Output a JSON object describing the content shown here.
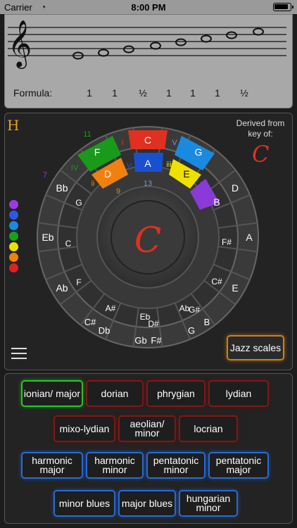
{
  "status_bar": {
    "carrier": "Carrier",
    "time": "8:00 PM"
  },
  "staff": {
    "formula_label": "Formula:",
    "steps": [
      "1",
      "1",
      "½",
      "1",
      "1",
      "1",
      "½"
    ]
  },
  "wheel": {
    "derived_label": "Derived from key of:",
    "derived_key": "C",
    "center_key": "C",
    "h_label": "H",
    "highlighted": [
      {
        "note": "C",
        "color": "#e03020"
      },
      {
        "note": "G",
        "color": "#1a8ae0"
      },
      {
        "note": "E",
        "color": "#f0e000"
      },
      {
        "note": "B",
        "color": "#8a3ad8"
      },
      {
        "note": "A",
        "color": "#1a50d0"
      },
      {
        "note": "D",
        "color": "#f08010"
      },
      {
        "note": "F",
        "color": "#1a9a1a"
      }
    ],
    "roman": [
      "I",
      "V",
      "iii",
      "vii",
      "vi",
      "ii",
      "IV"
    ],
    "degree_numbers": [
      "11",
      "7",
      "9",
      "13"
    ],
    "outer_notes": [
      "C",
      "G",
      "D",
      "A",
      "E",
      "B",
      "F#",
      "C#",
      "Gb",
      "Db",
      "Ab",
      "Eb",
      "Bb",
      "F"
    ],
    "inner_notes": [
      "G",
      "C",
      "F",
      "A#",
      "Eb",
      "D#",
      "Ab",
      "G#",
      "C#",
      "F#"
    ],
    "color_dots": [
      "#9a3ae0",
      "#2a5ae0",
      "#1a8ae0",
      "#1aa01a",
      "#f0e000",
      "#f08010",
      "#e02020"
    ],
    "jazz_button": "Jazz scales"
  },
  "scales": {
    "row1": [
      {
        "label": "ionian/ major",
        "style": "green"
      },
      {
        "label": "dorian",
        "style": "red"
      },
      {
        "label": "phrygian",
        "style": "red"
      },
      {
        "label": "lydian",
        "style": "red"
      }
    ],
    "row2": [
      {
        "label": "mixo-lydian",
        "style": "red"
      },
      {
        "label": "aeolian/ minor",
        "style": "red"
      },
      {
        "label": "locrian",
        "style": "red"
      }
    ],
    "row3": [
      {
        "label": "harmonic major",
        "style": "blue"
      },
      {
        "label": "harmonic minor",
        "style": "blue"
      },
      {
        "label": "pentatonic minor",
        "style": "blue"
      },
      {
        "label": "pentatonic major",
        "style": "blue"
      }
    ],
    "row4": [
      {
        "label": "minor blues",
        "style": "blue"
      },
      {
        "label": "major blues",
        "style": "blue"
      },
      {
        "label": "hungarian minor",
        "style": "blue"
      }
    ]
  }
}
